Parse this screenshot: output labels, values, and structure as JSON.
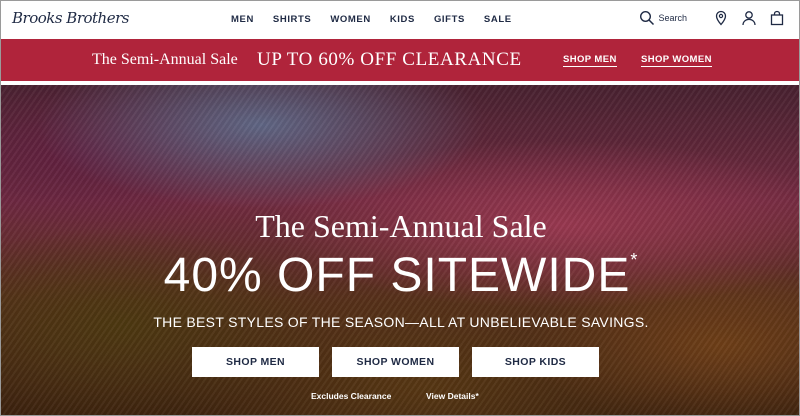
{
  "header": {
    "logo": "Brooks Brothers",
    "nav": [
      "MEN",
      "SHIRTS",
      "WOMEN",
      "KIDS",
      "GIFTS",
      "SALE"
    ],
    "search_label": "Search",
    "icons": [
      "search-icon",
      "location-pin-icon",
      "account-icon",
      "shopping-bag-icon"
    ]
  },
  "promo": {
    "title": "The Semi-Annual Sale",
    "offer": "UP TO 60% OFF CLEARANCE",
    "shop_men": "SHOP MEN",
    "shop_women": "SHOP WOMEN"
  },
  "hero": {
    "kicker": "The Semi-Annual Sale",
    "headline": "40% OFF SITEWIDE",
    "headline_mark": "*",
    "subhead": "THE BEST STYLES OF THE SEASON—ALL AT UNBELIEVABLE SAVINGS.",
    "buttons": [
      "SHOP MEN",
      "SHOP WOMEN",
      "SHOP KIDS"
    ],
    "excludes": "Excludes Clearance",
    "details": "View Details*"
  },
  "colors": {
    "brand_navy": "#1f2a44",
    "promo_red": "#b0243b"
  }
}
